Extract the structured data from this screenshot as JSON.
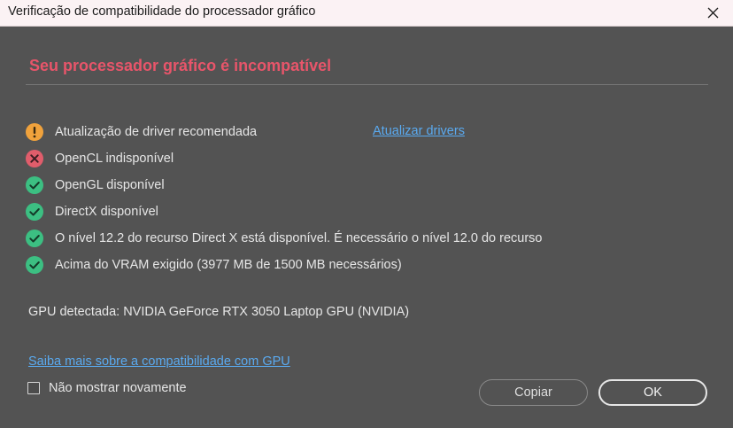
{
  "window": {
    "title": "Verificação de compatibilidade do processador gráfico",
    "close_icon": "close-icon"
  },
  "heading": "Seu processador gráfico é incompatível",
  "checks": [
    {
      "status": "warning",
      "icon": "warning-icon",
      "label": "Atualização de driver recomendada",
      "link": "Atualizar drivers"
    },
    {
      "status": "error",
      "icon": "error-icon",
      "label": "OpenCL indisponível"
    },
    {
      "status": "ok",
      "icon": "check-icon",
      "label": "OpenGL disponível"
    },
    {
      "status": "ok",
      "icon": "check-icon",
      "label": "DirectX disponível"
    },
    {
      "status": "ok",
      "icon": "check-icon",
      "label": "O nível 12.2 do recurso Direct X está disponível. É necessário o nível 12.0 do recurso"
    },
    {
      "status": "ok",
      "icon": "check-icon",
      "label": "Acima do VRAM exigido (3977 MB de 1500 MB necessários)"
    }
  ],
  "gpu_detected": "GPU detectada: NVIDIA GeForce RTX 3050 Laptop GPU (NVIDIA)",
  "learn_more_link": "Saiba mais sobre a compatibilidade com GPU",
  "dont_show_again": {
    "label": "Não mostrar novamente",
    "checked": false
  },
  "buttons": {
    "copy": "Copiar",
    "ok": "OK"
  },
  "colors": {
    "background": "#535353",
    "heading": "#e8556a",
    "link": "#5aaaf0",
    "warning": "#f0a23c",
    "error": "#e05d6b",
    "ok": "#3cbf82"
  }
}
